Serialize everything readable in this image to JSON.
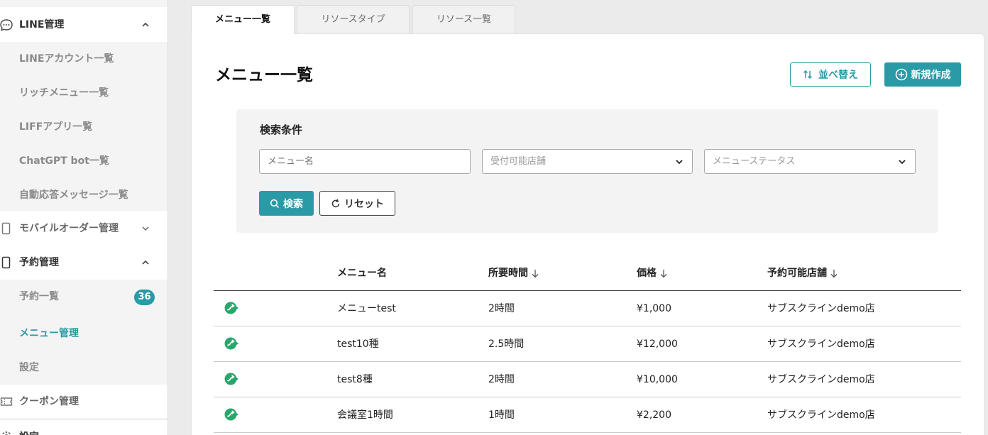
{
  "sidebar": {
    "groups": [
      {
        "label": "LINE管理",
        "expanded": true,
        "icon": "chat-bubble-icon"
      },
      {
        "label": "モバイルオーダー管理",
        "expanded": false,
        "icon": "mobile-icon"
      },
      {
        "label": "予約管理",
        "expanded": true,
        "icon": "mobile-icon"
      },
      {
        "label": "クーポン管理",
        "expanded": false,
        "icon": "coupon-icon"
      },
      {
        "label": "設定",
        "icon": "gear-icon"
      }
    ],
    "line_items": [
      {
        "label": "LINEアカウント一覧"
      },
      {
        "label": "リッチメニュー一覧"
      },
      {
        "label": "LIFFアプリ一覧"
      },
      {
        "label": "ChatGPT bot一覧"
      },
      {
        "label": "自動応答メッセージ一覧"
      }
    ],
    "reserve_items": [
      {
        "label": "予約一覧",
        "badge": "36"
      },
      {
        "label": "メニュー管理",
        "active": true
      },
      {
        "label": "設定"
      }
    ]
  },
  "tabs": [
    {
      "label": "メニュー一覧",
      "active": true
    },
    {
      "label": "リソースタイプ"
    },
    {
      "label": "リソース一覧"
    }
  ],
  "page": {
    "title": "メニュー一覧",
    "sort_label": "並べ替え",
    "new_label": "新規作成"
  },
  "search": {
    "title": "検索条件",
    "name_placeholder": "メニュー名",
    "store_placeholder": "受付可能店舗",
    "status_placeholder": "メニューステータス",
    "search_label": "検索",
    "reset_label": "リセット"
  },
  "table": {
    "columns": [
      {
        "label": "メニュー名",
        "sortable": false
      },
      {
        "label": "所要時間",
        "sortable": true
      },
      {
        "label": "価格",
        "sortable": true
      },
      {
        "label": "予約可能店舗",
        "sortable": true
      }
    ],
    "rows": [
      {
        "name": "メニューtest",
        "duration": "2時間",
        "price": "¥1,000",
        "store": "サブスクラインdemo店"
      },
      {
        "name": "test10種",
        "duration": "2.5時間",
        "price": "¥12,000",
        "store": "サブスクラインdemo店"
      },
      {
        "name": "test8種",
        "duration": "2時間",
        "price": "¥10,000",
        "store": "サブスクラインdemo店"
      },
      {
        "name": "会議室1時間",
        "duration": "1時間",
        "price": "¥2,200",
        "store": "サブスクラインdemo店"
      }
    ]
  },
  "colors": {
    "accent": "#2a9aa7",
    "status_green": "#27a86b",
    "status_teal": "#2a9aa7"
  }
}
